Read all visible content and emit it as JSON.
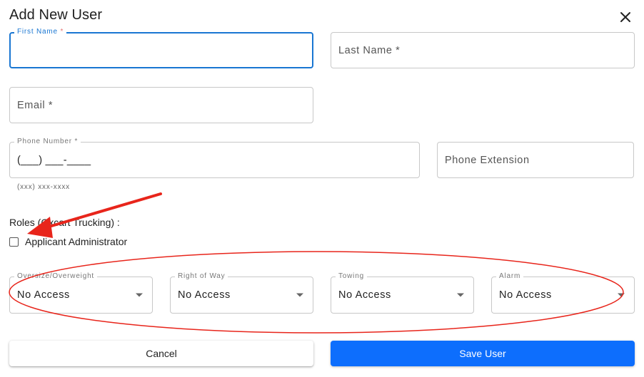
{
  "dialog": {
    "title": "Add New User",
    "close_icon": "close-icon"
  },
  "fields": {
    "first_name": {
      "label": "First Name",
      "required_mark": " *",
      "value": ""
    },
    "last_name": {
      "placeholder": "Last Name *"
    },
    "email": {
      "placeholder": "Email *"
    },
    "phone": {
      "label": "Phone Number *",
      "value": "(___) ___-____",
      "helper": "(xxx) xxx-xxxx"
    },
    "phone_extension": {
      "placeholder": "Phone Extension"
    }
  },
  "roles": {
    "label": "Roles (Oxcart Trucking) :",
    "checkbox_label": "Applicant Administrator",
    "checked": false
  },
  "permissions": [
    {
      "label": "Oversize/Overweight",
      "value": "No Access"
    },
    {
      "label": "Right of Way",
      "value": "No Access"
    },
    {
      "label": "Towing",
      "value": "No Access"
    },
    {
      "label": "Alarm",
      "value": "No Access"
    }
  ],
  "buttons": {
    "cancel": "Cancel",
    "save": "Save User"
  },
  "colors": {
    "focus_blue": "#1976d2",
    "required_orange": "#e57373",
    "primary_button": "#0d6efd",
    "annotation_red": "#e8251b"
  }
}
